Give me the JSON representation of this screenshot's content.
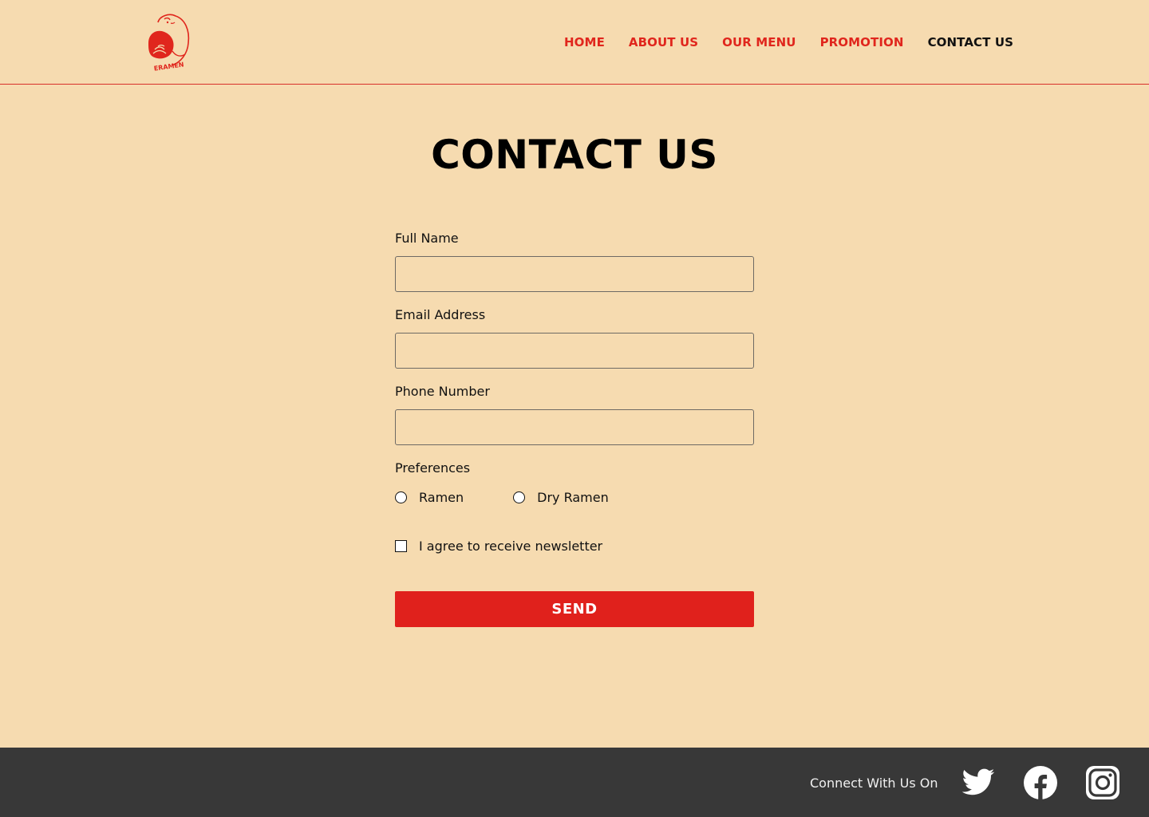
{
  "header": {
    "brand_text": "ERAMEN",
    "nav": [
      {
        "label": "HOME"
      },
      {
        "label": "ABOUT US"
      },
      {
        "label": "OUR MENU"
      },
      {
        "label": "PROMOTION"
      },
      {
        "label": "CONTACT US",
        "active": true
      }
    ]
  },
  "main": {
    "title": "CONTACT US",
    "form": {
      "full_name": {
        "label": "Full Name",
        "value": "",
        "placeholder": ""
      },
      "email": {
        "label": "Email Address",
        "value": "",
        "placeholder": ""
      },
      "phone": {
        "label": "Phone Number",
        "value": "",
        "placeholder": ""
      },
      "preferences": {
        "label": "Preferences",
        "options": [
          {
            "label": "Ramen",
            "selected": false
          },
          {
            "label": "Dry Ramen",
            "selected": false
          }
        ]
      },
      "newsletter": {
        "label": "I agree to receive newsletter",
        "checked": false
      },
      "submit_label": "SEND"
    }
  },
  "footer": {
    "connect_text": "Connect With Us On",
    "social": [
      {
        "icon": "twitter-icon"
      },
      {
        "icon": "facebook-icon"
      },
      {
        "icon": "instagram-icon"
      }
    ]
  },
  "colors": {
    "background": "#f6dbb0",
    "accent": "#e0211c",
    "footer": "#383838"
  }
}
